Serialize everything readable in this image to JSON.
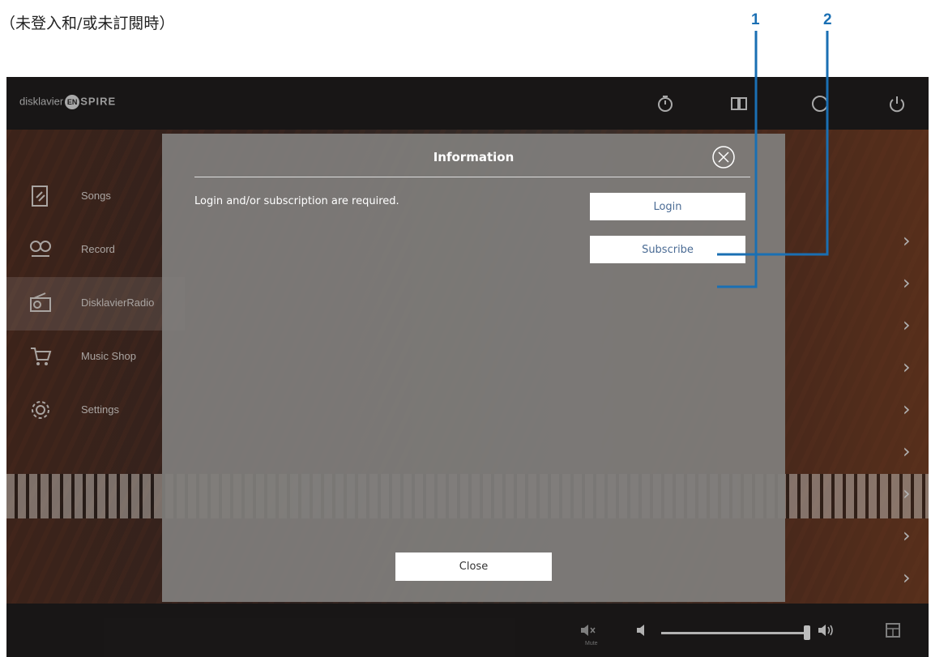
{
  "caption": "（未登入和/或未訂閱時）",
  "callouts": [
    "1",
    "2"
  ],
  "app": {
    "logo_prefix": "disklavier",
    "logo_badge": "EN",
    "logo_suffix": "SPIRE",
    "topbar_icons": [
      "timer-icon",
      "book-icon",
      "info-icon",
      "power-icon"
    ]
  },
  "sidebar": {
    "items": [
      {
        "label": "Songs",
        "icon": "songs-icon"
      },
      {
        "label": "Record",
        "icon": "record-icon"
      },
      {
        "label": "DisklavierRadio",
        "icon": "radio-icon"
      },
      {
        "label": "Music Shop",
        "icon": "cart-icon"
      },
      {
        "label": "Settings",
        "icon": "gear-icon"
      }
    ],
    "active_index": 2
  },
  "dialog": {
    "title": "Information",
    "message": "Login and/or subscription are required.",
    "login_label": "Login",
    "subscribe_label": "Subscribe",
    "close_label": "Close"
  },
  "bottombar": {
    "mute_label": "Mute"
  },
  "colors": {
    "callout": "#1a6fb3",
    "dialog_bg": "#807e7c",
    "button_text": "#4a6b94"
  }
}
